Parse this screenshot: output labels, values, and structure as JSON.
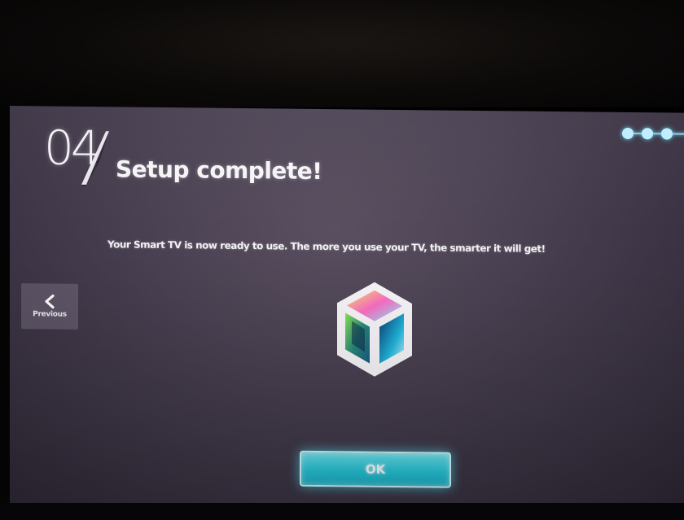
{
  "setup": {
    "step_number": "04",
    "title": "Setup complete!",
    "message": "Your Smart TV is now ready to use. The more you use your TV, the smarter it will get!",
    "progress": {
      "completed_steps": 4,
      "total_steps": 4,
      "dot_color": "#bfeeff",
      "line_color": "#7fd3ee"
    }
  },
  "navigation": {
    "previous_label": "Previous"
  },
  "actions": {
    "ok_label": "OK",
    "ok_color": "#27c9dc"
  },
  "icons": {
    "previous": "chevron-left-icon",
    "hub": "smart-hub-cube-icon"
  },
  "colors": {
    "screen_background": "#4b4253",
    "text": "#f5f3f6"
  }
}
